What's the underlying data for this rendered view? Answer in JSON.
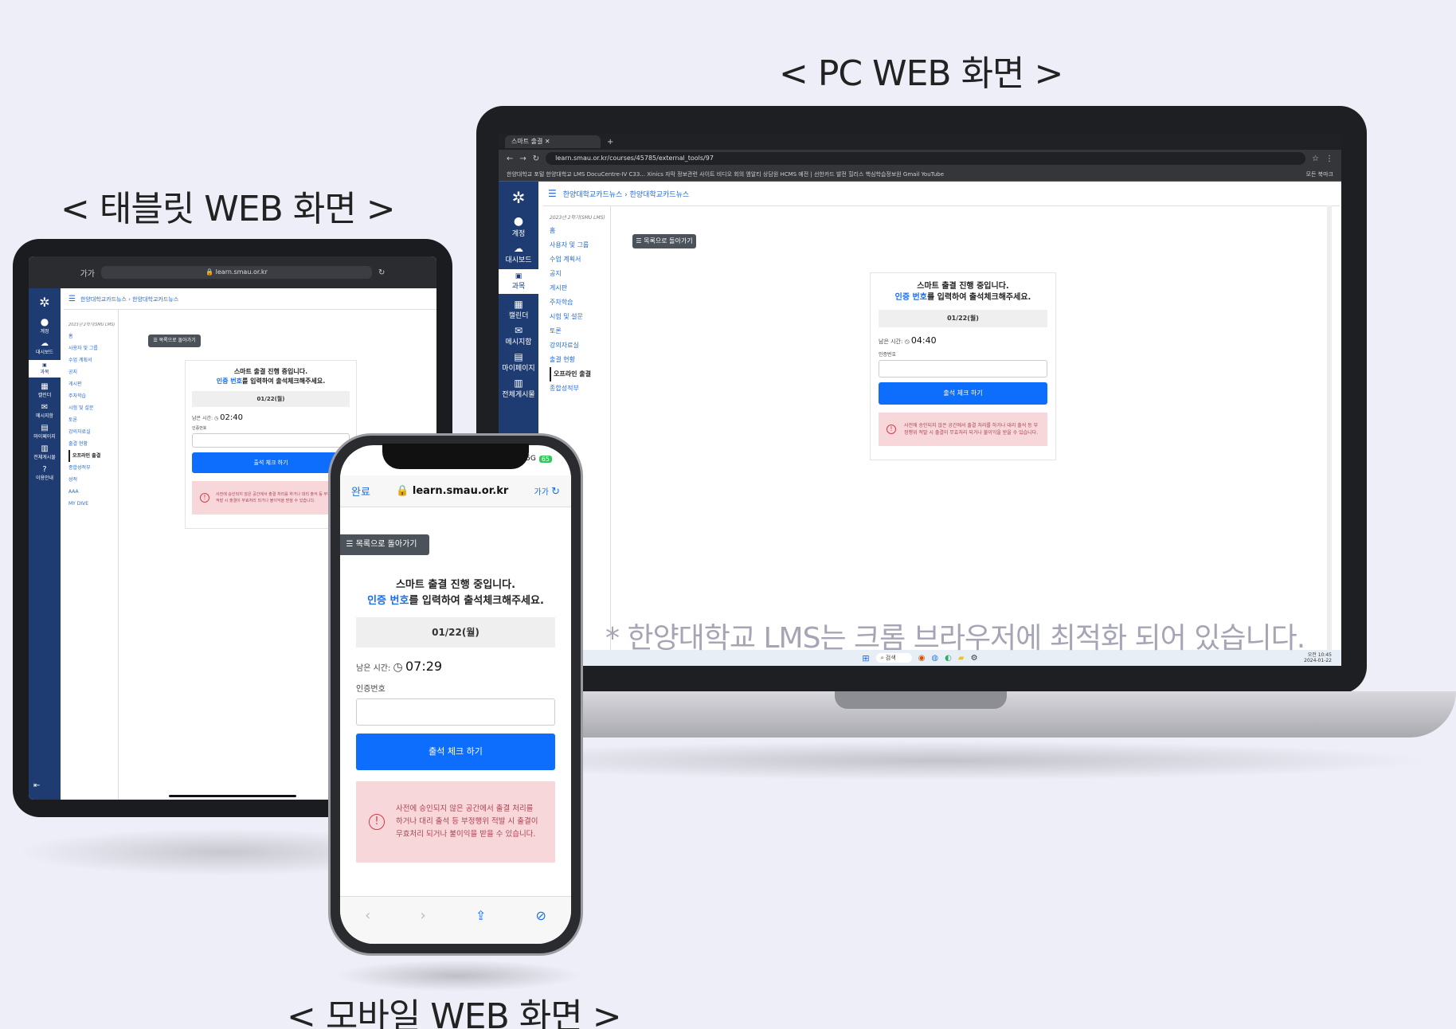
{
  "captions": {
    "pc": "< PC WEB 화면 >",
    "tablet": "< 태블릿 WEB 화면 >",
    "mobile": "< 모바일 WEB 화면 >",
    "footnote": "* 한양대학교 LMS는 크롬 브라우저에 최적화 되어 있습니다."
  },
  "attendance": {
    "title_line1": "스마트 출결 진행 중입니다.",
    "title_line2_highlight": "인증 번호",
    "title_line2_rest": "를 입력하여 출석체크해주세요.",
    "date": "01/22(월)",
    "remaining_label": "남은 시간:",
    "code_label": "인증번호",
    "submit_label": "출석 체크 하기",
    "warning": "사전에 승인되지 않은 공간에서 출결 처리를 하거나 대리 출석 등 부정행위 적발 시 출결이 무효처리 되거나 불이익을 받을 수 있습니다.",
    "back_label": "목록으로 돌아가기"
  },
  "pc": {
    "tab_title": "스마트 출결",
    "url": "learn.smau.or.kr/courses/45785/external_tools/97",
    "bookmarks": "한양대학교 포털   한양대학교 LMS   DocuCentre-IV C33...   Xinics 자막   정보관련 사이트   비디오 회의   엠알티 상담원   HCMS   예전 | 선한카드 발전   힐리스   핵심학습정보원   Gmail   YouTube",
    "all_bookmarks": "모든 북마크",
    "breadcrumb": "한양대학교카드뉴스 › 한양대학교카드뉴스",
    "term": "2023년 2학기(SMU LMS)",
    "remaining_time": "04:40",
    "nav_items": [
      "계정",
      "대시보드",
      "과목",
      "캘린더",
      "메시지함",
      "마이페이지",
      "전체게시물"
    ],
    "side_links": [
      "홈",
      "사용자 및 그룹",
      "수업 계획서",
      "공지",
      "게시판",
      "주차학습",
      "시험 및 설문",
      "토론",
      "강의자료실",
      "출결 현황",
      "오프라인 출결",
      "종합성적부"
    ],
    "taskbar_search": "검색",
    "clock_time": "오전 10:45",
    "clock_date": "2024-01-22"
  },
  "tablet": {
    "url": "learn.smau.or.kr",
    "aa": "가가",
    "breadcrumb": "한양대학교카드뉴스 › 한양대학교카드뉴스",
    "term": "2023년 2학기(SMU LMS)",
    "remaining_time": "02:40",
    "nav_items": [
      "계정",
      "대시보드",
      "과목",
      "캘린더",
      "메시지함",
      "마이페이지",
      "전체게시물",
      "이용안내"
    ],
    "side_links": [
      "홈",
      "사용자 및 그룹",
      "수업 계획서",
      "공지",
      "게시판",
      "주차학습",
      "시험 및 설문",
      "토론",
      "강의자료실",
      "출결 현황",
      "오프라인 출결",
      "종합성적부",
      "성적",
      "AAA",
      "MY DIVE"
    ]
  },
  "mobile": {
    "done_label": "완료",
    "url": "learn.smau.or.kr",
    "aa": "가가",
    "signal": "5G",
    "battery": "65",
    "remaining_time": "07:29"
  }
}
